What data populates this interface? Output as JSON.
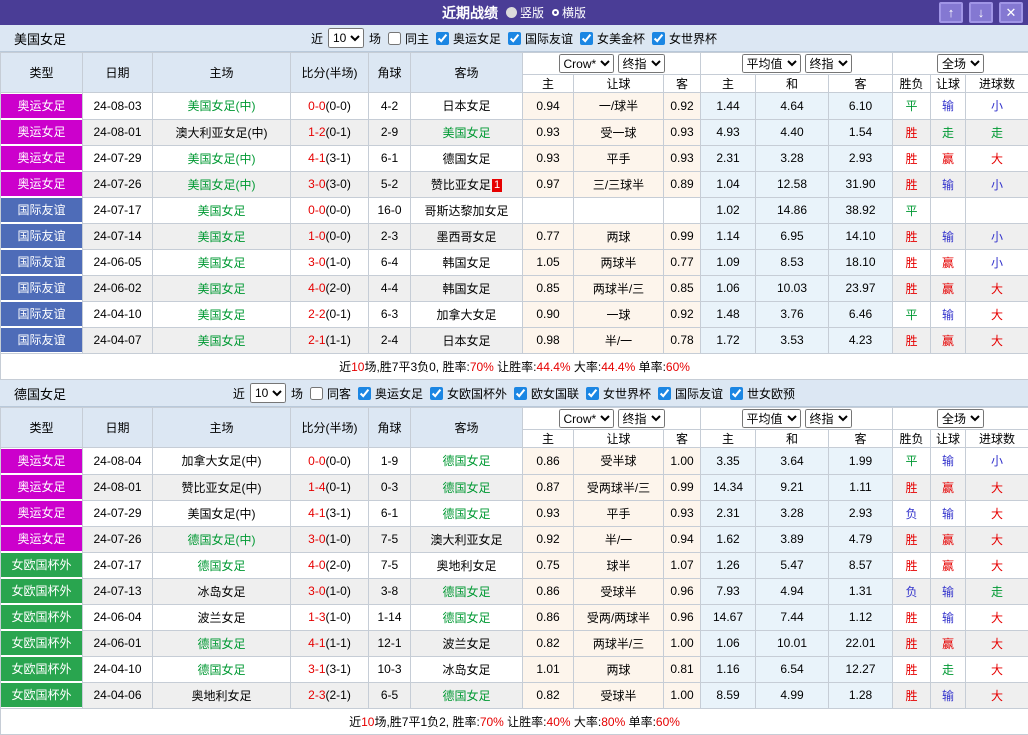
{
  "titlebar": {
    "title": "近期战绩",
    "vertical_label": "竖版",
    "horizontal_label": "横版",
    "icons": {
      "up": "↑",
      "down": "↓",
      "close": "✕"
    }
  },
  "colors": {
    "bar_purple": "#4a3d96",
    "button_purple": "#8478d2",
    "type_olympic": "#cc00cc",
    "type_friendly": "#4e6cb8",
    "type_eurocup": "#29a54f",
    "team_green": "#009933",
    "score_red": "#e60000",
    "result_red": "#e60000",
    "result_blue": "#3333cc",
    "result_green": "#009933",
    "header_bg": "#dce7f3",
    "row_alt": "#efefef",
    "odds_bg": "#fdf5ec",
    "avg_bg": "#e9f3fa",
    "checkbox_blue": "#1b86e3"
  },
  "table_labels": {
    "columns": [
      "类型",
      "日期",
      "主场",
      "比分(半场)",
      "角球",
      "客场"
    ],
    "sub_columns": [
      "主",
      "让球",
      "客",
      "主",
      "和",
      "客",
      "胜负",
      "让球",
      "进球数"
    ],
    "selects": {
      "source": "Crow*",
      "final1": "终指",
      "average": "平均值",
      "final2": "终指",
      "scope": "全场"
    }
  },
  "sections": [
    {
      "team": "美国女足",
      "filter": {
        "near": "近",
        "count": "10",
        "games": "场",
        "same": "同主",
        "competitions": [
          "奥运女足",
          "国际友谊",
          "女美金杯",
          "女世界杯"
        ]
      },
      "rows": [
        {
          "type": "奥运女足",
          "tc": "olympic",
          "date": "24-08-03",
          "home": "美国女足(中)",
          "hg": true,
          "ft": "0-0",
          "ht": "(0-0)",
          "corner": "4-2",
          "away": "日本女足",
          "ag": false,
          "badge": "",
          "o1": "0.94",
          "hc": "一/球半",
          "o2": "0.92",
          "a1": "1.44",
          "a2": "4.64",
          "a3": "6.10",
          "r1": "平",
          "c1": "g",
          "r2": "输",
          "c2": "b",
          "r3": "小",
          "c3": "b"
        },
        {
          "type": "奥运女足",
          "tc": "olympic",
          "date": "24-08-01",
          "home": "澳大利亚女足(中)",
          "hg": false,
          "ft": "1-2",
          "ht": "(0-1)",
          "corner": "2-9",
          "away": "美国女足",
          "ag": true,
          "badge": "",
          "o1": "0.93",
          "hc": "受一球",
          "o2": "0.93",
          "a1": "4.93",
          "a2": "4.40",
          "a3": "1.54",
          "r1": "胜",
          "c1": "r",
          "r2": "走",
          "c2": "g",
          "r3": "走",
          "c3": "g"
        },
        {
          "type": "奥运女足",
          "tc": "olympic",
          "date": "24-07-29",
          "home": "美国女足(中)",
          "hg": true,
          "ft": "4-1",
          "ht": "(3-1)",
          "corner": "6-1",
          "away": "德国女足",
          "ag": false,
          "badge": "",
          "o1": "0.93",
          "hc": "平手",
          "o2": "0.93",
          "a1": "2.31",
          "a2": "3.28",
          "a3": "2.93",
          "r1": "胜",
          "c1": "r",
          "r2": "赢",
          "c2": "r",
          "r3": "大",
          "c3": "r"
        },
        {
          "type": "奥运女足",
          "tc": "olympic",
          "date": "24-07-26",
          "home": "美国女足(中)",
          "hg": true,
          "ft": "3-0",
          "ht": "(3-0)",
          "corner": "5-2",
          "away": "赞比亚女足",
          "ag": false,
          "badge": "1",
          "o1": "0.97",
          "hc": "三/三球半",
          "o2": "0.89",
          "a1": "1.04",
          "a2": "12.58",
          "a3": "31.90",
          "r1": "胜",
          "c1": "r",
          "r2": "输",
          "c2": "b",
          "r3": "小",
          "c3": "b"
        },
        {
          "type": "国际友谊",
          "tc": "friendly",
          "date": "24-07-17",
          "home": "美国女足",
          "hg": true,
          "ft": "0-0",
          "ht": "(0-0)",
          "corner": "16-0",
          "away": "哥斯达黎加女足",
          "ag": false,
          "badge": "",
          "o1": "",
          "hc": "",
          "o2": "",
          "a1": "1.02",
          "a2": "14.86",
          "a3": "38.92",
          "r1": "平",
          "c1": "g",
          "r2": "",
          "c2": "",
          "r3": "",
          "c3": ""
        },
        {
          "type": "国际友谊",
          "tc": "friendly",
          "date": "24-07-14",
          "home": "美国女足",
          "hg": true,
          "ft": "1-0",
          "ht": "(0-0)",
          "corner": "2-3",
          "away": "墨西哥女足",
          "ag": false,
          "badge": "",
          "o1": "0.77",
          "hc": "两球",
          "o2": "0.99",
          "a1": "1.14",
          "a2": "6.95",
          "a3": "14.10",
          "r1": "胜",
          "c1": "r",
          "r2": "输",
          "c2": "b",
          "r3": "小",
          "c3": "b"
        },
        {
          "type": "国际友谊",
          "tc": "friendly",
          "date": "24-06-05",
          "home": "美国女足",
          "hg": true,
          "ft": "3-0",
          "ht": "(1-0)",
          "corner": "6-4",
          "away": "韩国女足",
          "ag": false,
          "badge": "",
          "o1": "1.05",
          "hc": "两球半",
          "o2": "0.77",
          "a1": "1.09",
          "a2": "8.53",
          "a3": "18.10",
          "r1": "胜",
          "c1": "r",
          "r2": "赢",
          "c2": "r",
          "r3": "小",
          "c3": "b"
        },
        {
          "type": "国际友谊",
          "tc": "friendly",
          "date": "24-06-02",
          "home": "美国女足",
          "hg": true,
          "ft": "4-0",
          "ht": "(2-0)",
          "corner": "4-4",
          "away": "韩国女足",
          "ag": false,
          "badge": "",
          "o1": "0.85",
          "hc": "两球半/三",
          "o2": "0.85",
          "a1": "1.06",
          "a2": "10.03",
          "a3": "23.97",
          "r1": "胜",
          "c1": "r",
          "r2": "赢",
          "c2": "r",
          "r3": "大",
          "c3": "r"
        },
        {
          "type": "国际友谊",
          "tc": "friendly",
          "date": "24-04-10",
          "home": "美国女足",
          "hg": true,
          "ft": "2-2",
          "ht": "(0-1)",
          "corner": "6-3",
          "away": "加拿大女足",
          "ag": false,
          "badge": "",
          "o1": "0.90",
          "hc": "一球",
          "o2": "0.92",
          "a1": "1.48",
          "a2": "3.76",
          "a3": "6.46",
          "r1": "平",
          "c1": "g",
          "r2": "输",
          "c2": "b",
          "r3": "大",
          "c3": "r"
        },
        {
          "type": "国际友谊",
          "tc": "friendly",
          "date": "24-04-07",
          "home": "美国女足",
          "hg": true,
          "ft": "2-1",
          "ht": "(1-1)",
          "corner": "2-4",
          "away": "日本女足",
          "ag": false,
          "badge": "",
          "o1": "0.98",
          "hc": "半/一",
          "o2": "0.78",
          "a1": "1.72",
          "a2": "3.53",
          "a3": "4.23",
          "r1": "胜",
          "c1": "r",
          "r2": "赢",
          "c2": "r",
          "r3": "大",
          "c3": "r"
        }
      ],
      "summary": [
        {
          "t": "近",
          "c": "k"
        },
        {
          "t": "10",
          "c": "r"
        },
        {
          "t": "场,胜7平3负0, 胜率:",
          "c": "k"
        },
        {
          "t": "70%",
          "c": "r"
        },
        {
          "t": " 让胜率:",
          "c": "k"
        },
        {
          "t": "44.4%",
          "c": "r"
        },
        {
          "t": " 大率:",
          "c": "k"
        },
        {
          "t": "44.4%",
          "c": "r"
        },
        {
          "t": " 单率:",
          "c": "k"
        },
        {
          "t": "60%",
          "c": "r"
        }
      ]
    },
    {
      "team": "德国女足",
      "filter": {
        "near": "近",
        "count": "10",
        "games": "场",
        "same": "同客",
        "competitions": [
          "奥运女足",
          "女欧国杯外",
          "欧女国联",
          "女世界杯",
          "国际友谊",
          "世女欧预"
        ]
      },
      "rows": [
        {
          "type": "奥运女足",
          "tc": "olympic",
          "date": "24-08-04",
          "home": "加拿大女足(中)",
          "hg": false,
          "ft": "0-0",
          "ht": "(0-0)",
          "corner": "1-9",
          "away": "德国女足",
          "ag": true,
          "badge": "",
          "o1": "0.86",
          "hc": "受半球",
          "o2": "1.00",
          "a1": "3.35",
          "a2": "3.64",
          "a3": "1.99",
          "r1": "平",
          "c1": "g",
          "r2": "输",
          "c2": "b",
          "r3": "小",
          "c3": "b"
        },
        {
          "type": "奥运女足",
          "tc": "olympic",
          "date": "24-08-01",
          "home": "赞比亚女足(中)",
          "hg": false,
          "ft": "1-4",
          "ht": "(0-1)",
          "corner": "0-3",
          "away": "德国女足",
          "ag": true,
          "badge": "",
          "o1": "0.87",
          "hc": "受两球半/三",
          "o2": "0.99",
          "a1": "14.34",
          "a2": "9.21",
          "a3": "1.11",
          "r1": "胜",
          "c1": "r",
          "r2": "赢",
          "c2": "r",
          "r3": "大",
          "c3": "r"
        },
        {
          "type": "奥运女足",
          "tc": "olympic",
          "date": "24-07-29",
          "home": "美国女足(中)",
          "hg": false,
          "ft": "4-1",
          "ht": "(3-1)",
          "corner": "6-1",
          "away": "德国女足",
          "ag": true,
          "badge": "",
          "o1": "0.93",
          "hc": "平手",
          "o2": "0.93",
          "a1": "2.31",
          "a2": "3.28",
          "a3": "2.93",
          "r1": "负",
          "c1": "b",
          "r2": "输",
          "c2": "b",
          "r3": "大",
          "c3": "r"
        },
        {
          "type": "奥运女足",
          "tc": "olympic",
          "date": "24-07-26",
          "home": "德国女足(中)",
          "hg": true,
          "ft": "3-0",
          "ht": "(1-0)",
          "corner": "7-5",
          "away": "澳大利亚女足",
          "ag": false,
          "badge": "",
          "o1": "0.92",
          "hc": "半/一",
          "o2": "0.94",
          "a1": "1.62",
          "a2": "3.89",
          "a3": "4.79",
          "r1": "胜",
          "c1": "r",
          "r2": "赢",
          "c2": "r",
          "r3": "大",
          "c3": "r"
        },
        {
          "type": "女欧国杯外",
          "tc": "eurocup",
          "date": "24-07-17",
          "home": "德国女足",
          "hg": true,
          "ft": "4-0",
          "ht": "(2-0)",
          "corner": "7-5",
          "away": "奥地利女足",
          "ag": false,
          "badge": "",
          "o1": "0.75",
          "hc": "球半",
          "o2": "1.07",
          "a1": "1.26",
          "a2": "5.47",
          "a3": "8.57",
          "r1": "胜",
          "c1": "r",
          "r2": "赢",
          "c2": "r",
          "r3": "大",
          "c3": "r"
        },
        {
          "type": "女欧国杯外",
          "tc": "eurocup",
          "date": "24-07-13",
          "home": "冰岛女足",
          "hg": false,
          "ft": "3-0",
          "ht": "(1-0)",
          "corner": "3-8",
          "away": "德国女足",
          "ag": true,
          "badge": "",
          "o1": "0.86",
          "hc": "受球半",
          "o2": "0.96",
          "a1": "7.93",
          "a2": "4.94",
          "a3": "1.31",
          "r1": "负",
          "c1": "b",
          "r2": "输",
          "c2": "b",
          "r3": "走",
          "c3": "g"
        },
        {
          "type": "女欧国杯外",
          "tc": "eurocup",
          "date": "24-06-04",
          "home": "波兰女足",
          "hg": false,
          "ft": "1-3",
          "ht": "(1-0)",
          "corner": "1-14",
          "away": "德国女足",
          "ag": true,
          "badge": "",
          "o1": "0.86",
          "hc": "受两/两球半",
          "o2": "0.96",
          "a1": "14.67",
          "a2": "7.44",
          "a3": "1.12",
          "r1": "胜",
          "c1": "r",
          "r2": "输",
          "c2": "b",
          "r3": "大",
          "c3": "r"
        },
        {
          "type": "女欧国杯外",
          "tc": "eurocup",
          "date": "24-06-01",
          "home": "德国女足",
          "hg": true,
          "ft": "4-1",
          "ht": "(1-1)",
          "corner": "12-1",
          "away": "波兰女足",
          "ag": false,
          "badge": "",
          "o1": "0.82",
          "hc": "两球半/三",
          "o2": "1.00",
          "a1": "1.06",
          "a2": "10.01",
          "a3": "22.01",
          "r1": "胜",
          "c1": "r",
          "r2": "赢",
          "c2": "r",
          "r3": "大",
          "c3": "r"
        },
        {
          "type": "女欧国杯外",
          "tc": "eurocup",
          "date": "24-04-10",
          "home": "德国女足",
          "hg": true,
          "ft": "3-1",
          "ht": "(3-1)",
          "corner": "10-3",
          "away": "冰岛女足",
          "ag": false,
          "badge": "",
          "o1": "1.01",
          "hc": "两球",
          "o2": "0.81",
          "a1": "1.16",
          "a2": "6.54",
          "a3": "12.27",
          "r1": "胜",
          "c1": "r",
          "r2": "走",
          "c2": "g",
          "r3": "大",
          "c3": "r"
        },
        {
          "type": "女欧国杯外",
          "tc": "eurocup",
          "date": "24-04-06",
          "home": "奥地利女足",
          "hg": false,
          "ft": "2-3",
          "ht": "(2-1)",
          "corner": "6-5",
          "away": "德国女足",
          "ag": true,
          "badge": "",
          "o1": "0.82",
          "hc": "受球半",
          "o2": "1.00",
          "a1": "8.59",
          "a2": "4.99",
          "a3": "1.28",
          "r1": "胜",
          "c1": "r",
          "r2": "输",
          "c2": "b",
          "r3": "大",
          "c3": "r"
        }
      ],
      "summary": [
        {
          "t": "近",
          "c": "k"
        },
        {
          "t": "10",
          "c": "r"
        },
        {
          "t": "场,胜7平1负2, 胜率:",
          "c": "k"
        },
        {
          "t": "70%",
          "c": "r"
        },
        {
          "t": " 让胜率:",
          "c": "k"
        },
        {
          "t": "40%",
          "c": "r"
        },
        {
          "t": " 大率:",
          "c": "k"
        },
        {
          "t": "80%",
          "c": "r"
        },
        {
          "t": " 单率:",
          "c": "k"
        },
        {
          "t": "60%",
          "c": "r"
        }
      ]
    }
  ]
}
